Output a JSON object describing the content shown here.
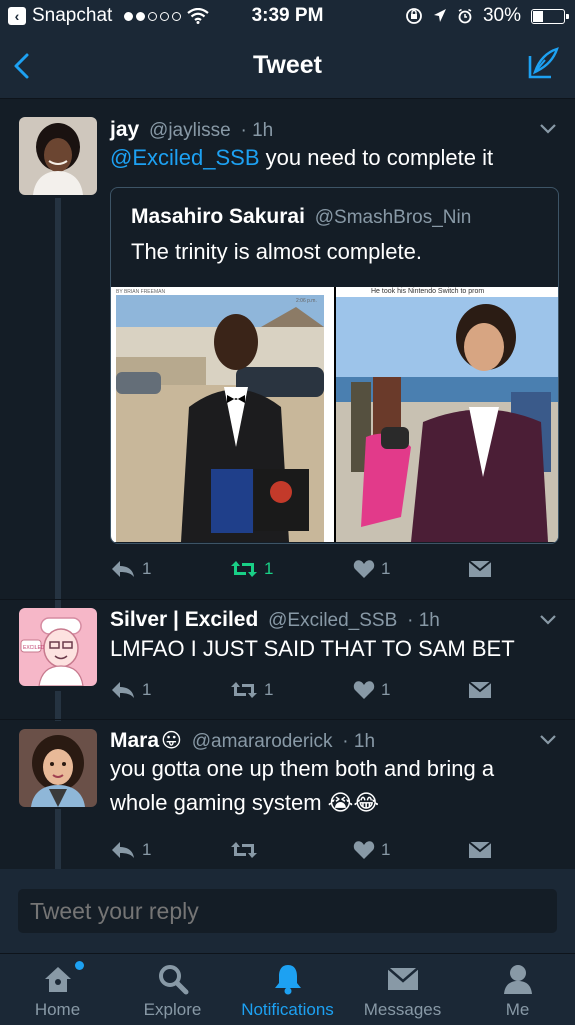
{
  "status_bar": {
    "carrier": "Snapchat",
    "time": "3:39 PM",
    "battery": "30%",
    "battery_level": 0.3
  },
  "nav": {
    "title": "Tweet"
  },
  "tweets": [
    {
      "name": "jay",
      "handle": "@jaylisse",
      "time": "· 1h",
      "mention": "@Exciled_SSB",
      "text": " you need to complete it",
      "quote": {
        "name": "Masahiro Sakurai",
        "handle": "@SmashBros_Nin",
        "text": "The trinity is almost complete.",
        "photo_left_caption": "2:06 p.m.",
        "photo_right_caption": "He took his Nintendo Switch to prom"
      },
      "reply_count": "1",
      "retweet_count": "1",
      "like_count": "1",
      "retweeted": true
    },
    {
      "name": "Silver | Exciled",
      "handle": "@Exciled_SSB",
      "time": "· 1h",
      "text": "LMFAO I JUST SAID THAT TO SAM BET",
      "avatar_text": "EXCILED",
      "reply_count": "1",
      "retweet_count": "1",
      "like_count": "1"
    },
    {
      "name": "Mara",
      "name_emoji": "😛",
      "handle": "@amararoderick",
      "time": "· 1h",
      "text": "you gotta one up them both and bring a whole gaming system 😭😂",
      "reply_count": "1",
      "retweet_count": "",
      "like_count": "1"
    }
  ],
  "reply_box": {
    "placeholder": "Tweet your reply"
  },
  "tabs": [
    {
      "label": "Home",
      "icon": "home-icon"
    },
    {
      "label": "Explore",
      "icon": "search-icon"
    },
    {
      "label": "Notifications",
      "icon": "bell-icon"
    },
    {
      "label": "Messages",
      "icon": "envelope-icon"
    },
    {
      "label": "Me",
      "icon": "person-icon"
    }
  ],
  "colors": {
    "accent": "#1da1f2",
    "retweet_green": "#19cf86",
    "background": "#141d26",
    "bar": "#1b2836",
    "muted": "#8899a6"
  }
}
